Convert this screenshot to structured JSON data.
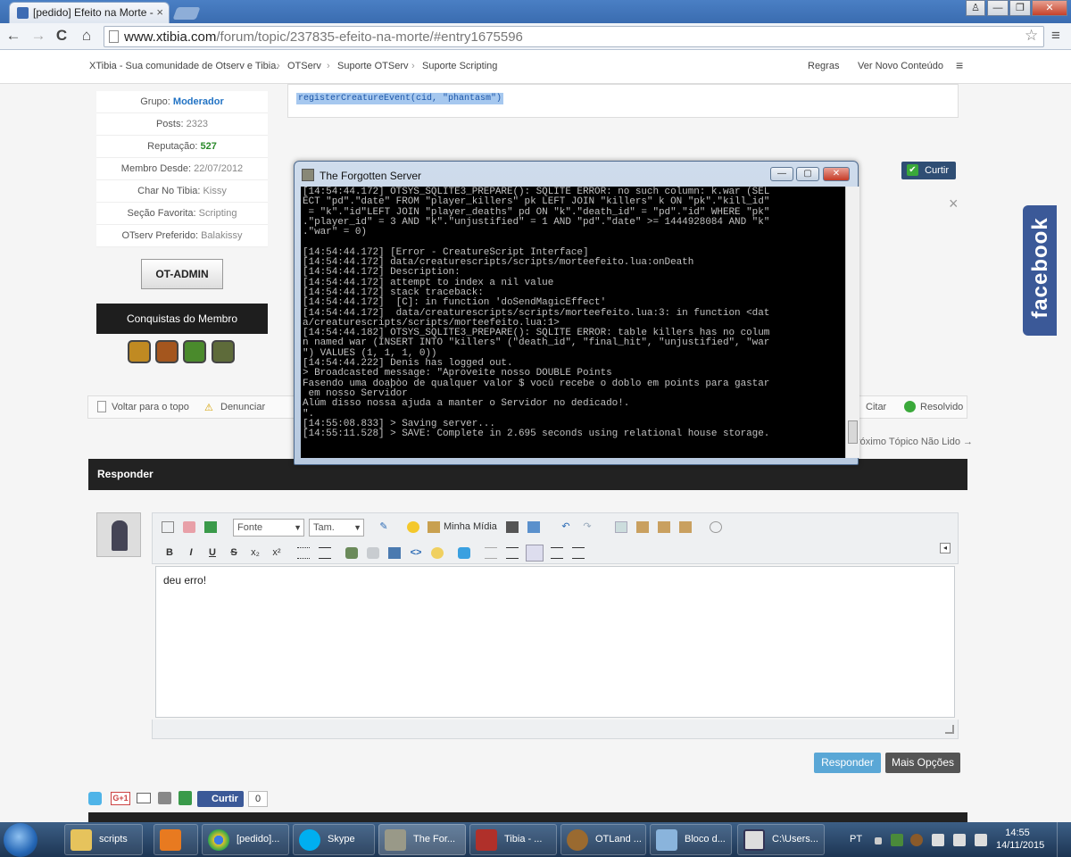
{
  "browser": {
    "tab_title": "[pedido] Efeito na Morte -",
    "tab_close": "×",
    "url_host": "www.xtibia.com",
    "url_path": "/forum/topic/237835-efeito-na-morte/#entry1675596",
    "back": "←",
    "forward": "→",
    "reload": "C",
    "home": "⌂",
    "star": "☆",
    "menu": "≡",
    "window_user": "♙",
    "window_min": "—",
    "window_max": "❐",
    "window_close": "✕"
  },
  "site": {
    "breadcrumb": [
      "XTibia - Sua comunidade de Otserv e Tibia.",
      "OTServ",
      "Suporte OTServ",
      "Suporte Scripting"
    ],
    "sep": "›",
    "right_links": [
      "Regras",
      "Ver Novo Conteúdo"
    ],
    "menu_icon": "≡"
  },
  "profile": {
    "rows": [
      {
        "label": "Grupo:",
        "value": "Moderador"
      },
      {
        "label": "Posts:",
        "value": "2323"
      },
      {
        "label": "Reputação:",
        "value": "527"
      },
      {
        "label": "Membro Desde:",
        "value": "22/07/2012"
      },
      {
        "label": "Char No Tibia:",
        "value": "Kissy"
      },
      {
        "label": "Seção Favorita:",
        "value": "Scripting"
      },
      {
        "label": "OTserv Preferido:",
        "value": "Balakissy"
      }
    ],
    "badge_label": "OT-ADMIN",
    "achievements_title": "Conquistas do Membro"
  },
  "post": {
    "code_selected": "registerCreatureEvent(cid, \"phantasm\")",
    "like_label": "Curtir",
    "like_check": "✔",
    "close_x": "×"
  },
  "actions": {
    "back_to_top": "Voltar para o topo",
    "report": "Denunciar",
    "quote": "Citar",
    "solved": "Resolvido",
    "next_topic": "róximo Tópico Não Lido →"
  },
  "console": {
    "title": "The Forgotten Server",
    "min": "—",
    "max": "▢",
    "close": "✕",
    "text": "[14:54:44.172] OTSYS_SQLITE3_PREPARE(): SQLITE ERROR: no such column: k.war (SEL\nECT \"pd\".\"date\" FROM \"player_killers\" pk LEFT JOIN \"killers\" k ON \"pk\".\"kill_id\"\n = \"k\".\"id\"LEFT JOIN \"player_deaths\" pd ON \"k\".\"death_id\" = \"pd\".\"id\" WHERE \"pk\"\n.\"player_id\" = 3 AND \"k\".\"unjustified\" = 1 AND \"pd\".\"date\" >= 1444928084 AND \"k\"\n.\"war\" = 0)\n\n[14:54:44.172] [Error - CreatureScript Interface]\n[14:54:44.172] data/creaturescripts/scripts/morteefeito.lua:onDeath\n[14:54:44.172] Description:\n[14:54:44.172] attempt to index a nil value\n[14:54:44.172] stack traceback:\n[14:54:44.172]  [C]: in function 'doSendMagicEffect'\n[14:54:44.172]  data/creaturescripts/scripts/morteefeito.lua:3: in function <dat\na/creaturescripts/scripts/morteefeito.lua:1>\n[14:54:44.182] OTSYS_SQLITE3_PREPARE(): SQLITE ERROR: table killers has no colum\nn named war (INSERT INTO \"killers\" (\"death_id\", \"final_hit\", \"unjustified\", \"war\n\") VALUES (1, 1, 1, 0))\n[14:54:44.222] Denis has logged out.\n> Broadcasted message: \"Aproveite nosso DOUBLE Points\nFasendo uma doaþòo de qualquer valor $ vocû recebe o doblo em points para gastar\n em nosso Servidor\nAlúm disso nossa ajuda a manter o Servidor no dedicado!.\n\".\n[14:55:08.833] > Saving server...\n[14:55:11.528] > SAVE: Complete in 2.695 seconds using relational house storage."
  },
  "reply": {
    "title": "Responder",
    "font_placeholder": "Fonte",
    "size_placeholder": "Tam.",
    "media_label": "Minha Mídia",
    "content": "deu erro!",
    "submit": "Responder",
    "more": "Mais Opções",
    "fb_like": "Curtir",
    "fb_count": "0",
    "fb_side": "facebook",
    "tb_bold": "B",
    "tb_italic": "I",
    "tb_underline": "U",
    "tb_strike": "S",
    "tb_sub": "x₂",
    "tb_sup": "x²"
  },
  "taskbar": {
    "items": [
      "scripts",
      "",
      "[pedido]...",
      "Skype",
      "The For...",
      "Tibia - ...",
      "OTLand ...",
      "Bloco d...",
      "C:\\Users..."
    ],
    "lang": "PT",
    "time": "14:55",
    "date": "14/11/2015"
  },
  "colors": {
    "accent": "#2273c4",
    "facebook": "#3b5998",
    "console_bg": "#000000",
    "console_fg": "#c0c0c0"
  }
}
